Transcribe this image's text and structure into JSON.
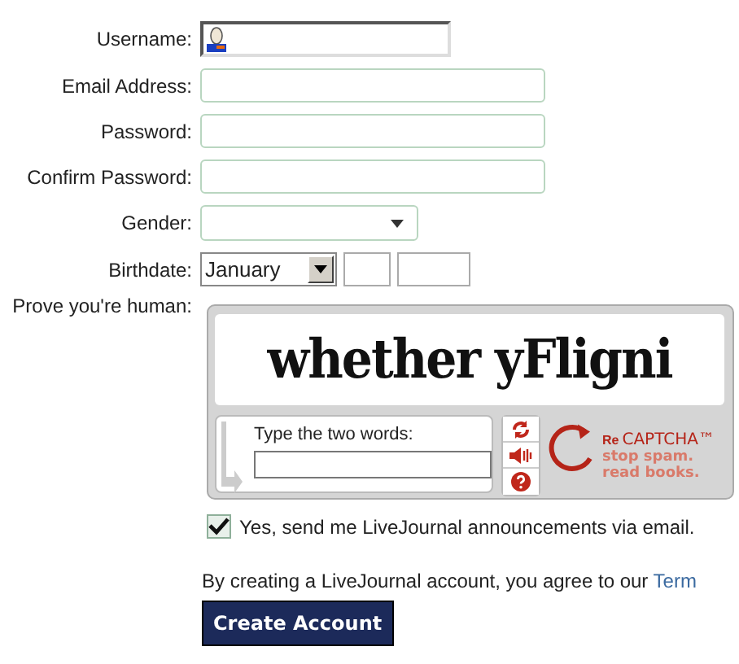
{
  "fields": [
    {
      "label": "Username:",
      "kind": "username"
    },
    {
      "label": "Email Address:",
      "kind": "text"
    },
    {
      "label": "Password:",
      "kind": "text"
    },
    {
      "label": "Confirm Password:",
      "kind": "text"
    },
    {
      "label": "Gender:",
      "kind": "select"
    },
    {
      "label": "Birthdate:",
      "kind": "date",
      "month": "January"
    }
  ],
  "captcha": {
    "label": "Prove you're human:",
    "words": "whether yFligni",
    "prompt": "Type the two words:",
    "logo_prefix": "Re",
    "logo_name": "CAPTCHA™",
    "tagline": [
      "stop spam.",
      "read books."
    ]
  },
  "newsletter": {
    "label": "Yes, send me LiveJournal announcements via email.",
    "checked": true
  },
  "terms": {
    "text": "By creating a LiveJournal account, you agree to our",
    "link": "Term"
  },
  "submit": "Create Account"
}
